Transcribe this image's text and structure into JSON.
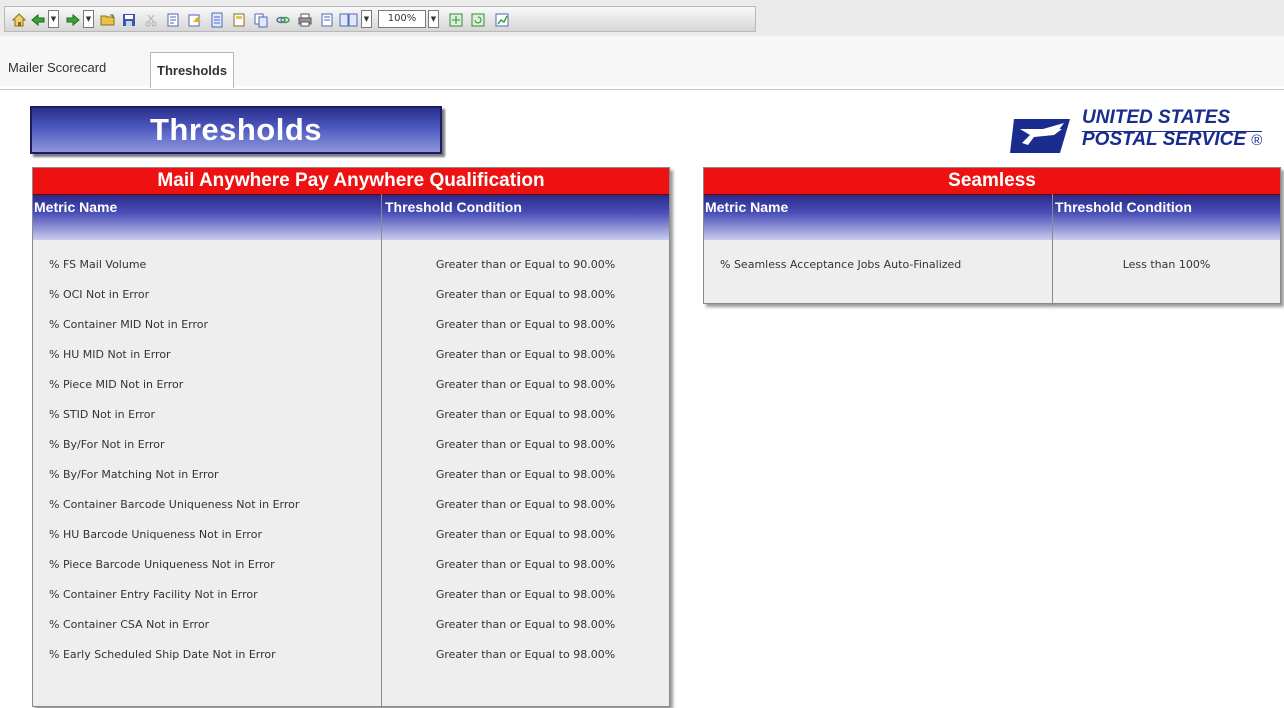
{
  "toolbar": {
    "zoom": "100%",
    "icons": [
      "home-icon",
      "back-icon",
      "forward-icon",
      "open-folder-icon",
      "save-icon",
      "cut-icon",
      "page-icon",
      "export-icon",
      "document-icon",
      "report-icon",
      "copy-icon",
      "link-icon",
      "print-icon",
      "page-setup-icon",
      "layout-icon",
      "view-icon",
      "refresh-icon",
      "chart-icon"
    ]
  },
  "tabs": [
    {
      "label": "Mailer Scorecard",
      "active": false
    },
    {
      "label": "Thresholds",
      "active": true
    }
  ],
  "page": {
    "title": "Thresholds",
    "logo_line1": "UNITED STATES",
    "logo_line2": "POSTAL SERVICE",
    "logo_mark": "®"
  },
  "mail_anywhere": {
    "title": "Mail Anywhere Pay Anywhere Qualification",
    "col_metric": "Metric Name",
    "col_threshold": "Threshold Condition",
    "rows": [
      {
        "metric": "% FS Mail Volume",
        "threshold": "Greater than or Equal to 90.00%"
      },
      {
        "metric": "% OCI Not in Error",
        "threshold": "Greater than or Equal to 98.00%"
      },
      {
        "metric": "% Container MID Not in Error",
        "threshold": "Greater than or Equal to 98.00%"
      },
      {
        "metric": "% HU MID Not in Error",
        "threshold": "Greater than or Equal to 98.00%"
      },
      {
        "metric": "% Piece MID Not in Error",
        "threshold": "Greater than or Equal to 98.00%"
      },
      {
        "metric": "% STID Not in Error",
        "threshold": "Greater than or Equal to 98.00%"
      },
      {
        "metric": "% By/For Not in Error",
        "threshold": "Greater than or Equal to 98.00%"
      },
      {
        "metric": "% By/For Matching Not in Error",
        "threshold": "Greater than or Equal to 98.00%"
      },
      {
        "metric": "% Container Barcode Uniqueness Not in Error",
        "threshold": "Greater than or Equal to 98.00%"
      },
      {
        "metric": "% HU Barcode Uniqueness Not in Error",
        "threshold": "Greater than or Equal to 98.00%"
      },
      {
        "metric": "% Piece Barcode Uniqueness Not in Error",
        "threshold": "Greater than or Equal to 98.00%"
      },
      {
        "metric": "% Container Entry Facility Not in Error",
        "threshold": "Greater than or Equal to 98.00%"
      },
      {
        "metric": "% Container CSA Not in Error",
        "threshold": "Greater than or Equal to 98.00%"
      },
      {
        "metric": "% Early Scheduled Ship Date Not in Error",
        "threshold": "Greater than or Equal to 98.00%"
      }
    ]
  },
  "seamless": {
    "title": "Seamless",
    "col_metric": "Metric Name",
    "col_threshold": "Threshold Condition",
    "rows": [
      {
        "metric": "% Seamless Acceptance Jobs Auto-Finalized",
        "threshold": "Less than 100%"
      }
    ]
  },
  "colors": {
    "panel_header_red": "#ee1111",
    "header_blue": "#2a2a8a",
    "usps_blue": "#1a2d8f"
  }
}
